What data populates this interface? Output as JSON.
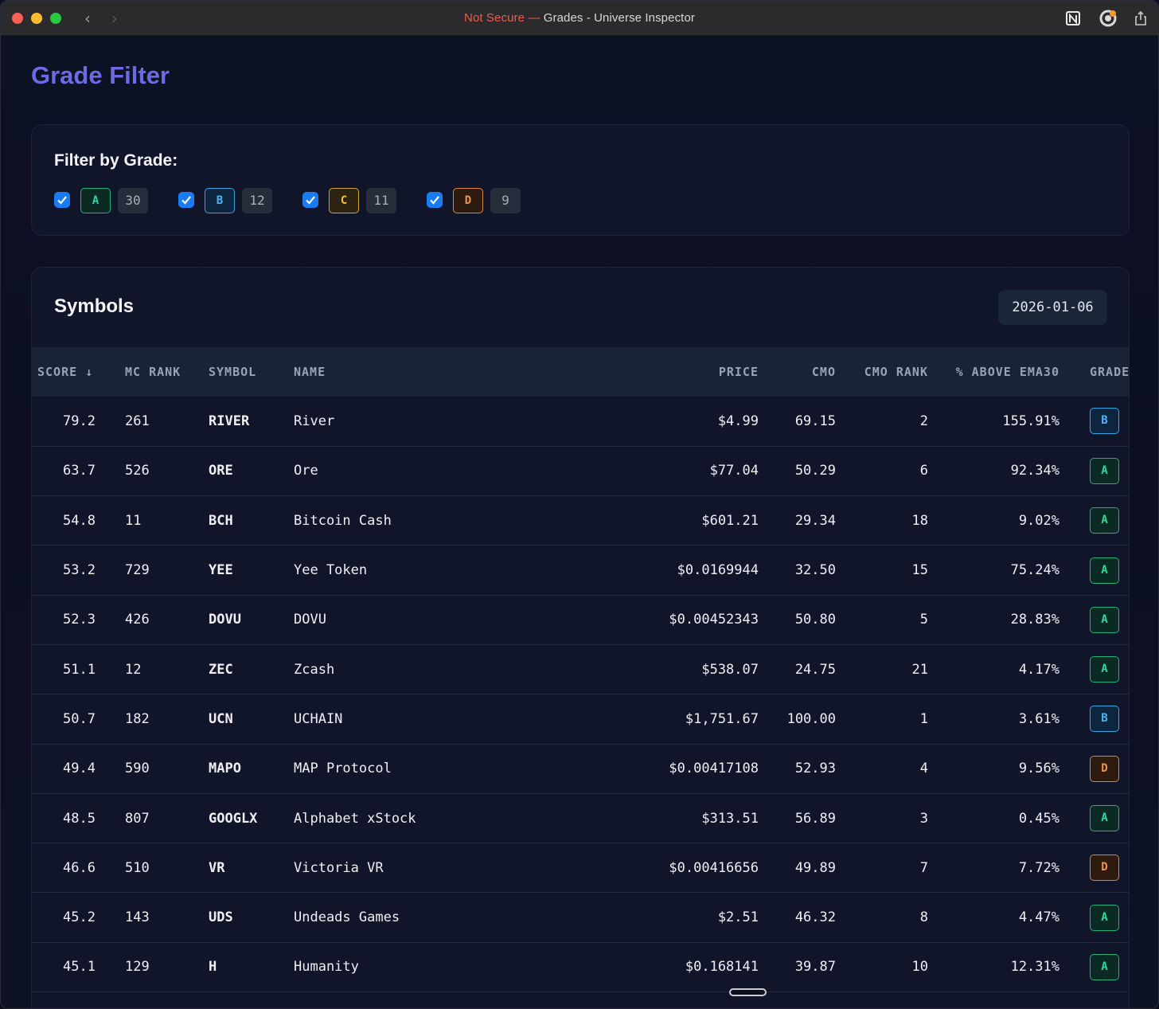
{
  "titlebar": {
    "insecure_label": "Not Secure —",
    "page_title": "Grades - Universe Inspector"
  },
  "page": {
    "title": "Grade Filter"
  },
  "filter": {
    "label": "Filter by Grade:",
    "grades": [
      {
        "grade": "A",
        "count": "30",
        "checked": true
      },
      {
        "grade": "B",
        "count": "12",
        "checked": true
      },
      {
        "grade": "C",
        "count": "11",
        "checked": true
      },
      {
        "grade": "D",
        "count": "9",
        "checked": true
      }
    ]
  },
  "symbols": {
    "title": "Symbols",
    "date": "2026-01-06",
    "columns": [
      "SCORE ↓",
      "MC RANK",
      "SYMBOL",
      "NAME",
      "PRICE",
      "CMO",
      "CMO RANK",
      "% ABOVE EMA30",
      "GRADE"
    ],
    "rows": [
      {
        "score": "79.2",
        "mc_rank": "261",
        "symbol": "RIVER",
        "name": "River",
        "price": "$4.99",
        "cmo": "69.15",
        "cmo_rank": "2",
        "pct": "155.91%",
        "grade": "B"
      },
      {
        "score": "63.7",
        "mc_rank": "526",
        "symbol": "ORE",
        "name": "Ore",
        "price": "$77.04",
        "cmo": "50.29",
        "cmo_rank": "6",
        "pct": "92.34%",
        "grade": "A"
      },
      {
        "score": "54.8",
        "mc_rank": "11",
        "symbol": "BCH",
        "name": "Bitcoin Cash",
        "price": "$601.21",
        "cmo": "29.34",
        "cmo_rank": "18",
        "pct": "9.02%",
        "grade": "A"
      },
      {
        "score": "53.2",
        "mc_rank": "729",
        "symbol": "YEE",
        "name": "Yee Token",
        "price": "$0.0169944",
        "cmo": "32.50",
        "cmo_rank": "15",
        "pct": "75.24%",
        "grade": "A"
      },
      {
        "score": "52.3",
        "mc_rank": "426",
        "symbol": "DOVU",
        "name": "DOVU",
        "price": "$0.00452343",
        "cmo": "50.80",
        "cmo_rank": "5",
        "pct": "28.83%",
        "grade": "A"
      },
      {
        "score": "51.1",
        "mc_rank": "12",
        "symbol": "ZEC",
        "name": "Zcash",
        "price": "$538.07",
        "cmo": "24.75",
        "cmo_rank": "21",
        "pct": "4.17%",
        "grade": "A"
      },
      {
        "score": "50.7",
        "mc_rank": "182",
        "symbol": "UCN",
        "name": "UCHAIN",
        "price": "$1,751.67",
        "cmo": "100.00",
        "cmo_rank": "1",
        "pct": "3.61%",
        "grade": "B"
      },
      {
        "score": "49.4",
        "mc_rank": "590",
        "symbol": "MAPO",
        "name": "MAP Protocol",
        "price": "$0.00417108",
        "cmo": "52.93",
        "cmo_rank": "4",
        "pct": "9.56%",
        "grade": "D"
      },
      {
        "score": "48.5",
        "mc_rank": "807",
        "symbol": "GOOGLX",
        "name": "Alphabet xStock",
        "price": "$313.51",
        "cmo": "56.89",
        "cmo_rank": "3",
        "pct": "0.45%",
        "grade": "A"
      },
      {
        "score": "46.6",
        "mc_rank": "510",
        "symbol": "VR",
        "name": "Victoria VR",
        "price": "$0.00416656",
        "cmo": "49.89",
        "cmo_rank": "7",
        "pct": "7.72%",
        "grade": "D"
      },
      {
        "score": "45.2",
        "mc_rank": "143",
        "symbol": "UDS",
        "name": "Undeads Games",
        "price": "$2.51",
        "cmo": "46.32",
        "cmo_rank": "8",
        "pct": "4.47%",
        "grade": "A"
      },
      {
        "score": "45.1",
        "mc_rank": "129",
        "symbol": "H",
        "name": "Humanity",
        "price": "$0.168141",
        "cmo": "39.87",
        "cmo_rank": "10",
        "pct": "12.31%",
        "grade": "A"
      }
    ]
  },
  "colors": {
    "accent_title": "#6d6ae4",
    "grade_A": "#2fd59a",
    "grade_B": "#4db5f5",
    "grade_C": "#f1c23b",
    "grade_D": "#f1924a",
    "checkbox": "#1a7cf5",
    "insecure": "#ef5b4a"
  }
}
